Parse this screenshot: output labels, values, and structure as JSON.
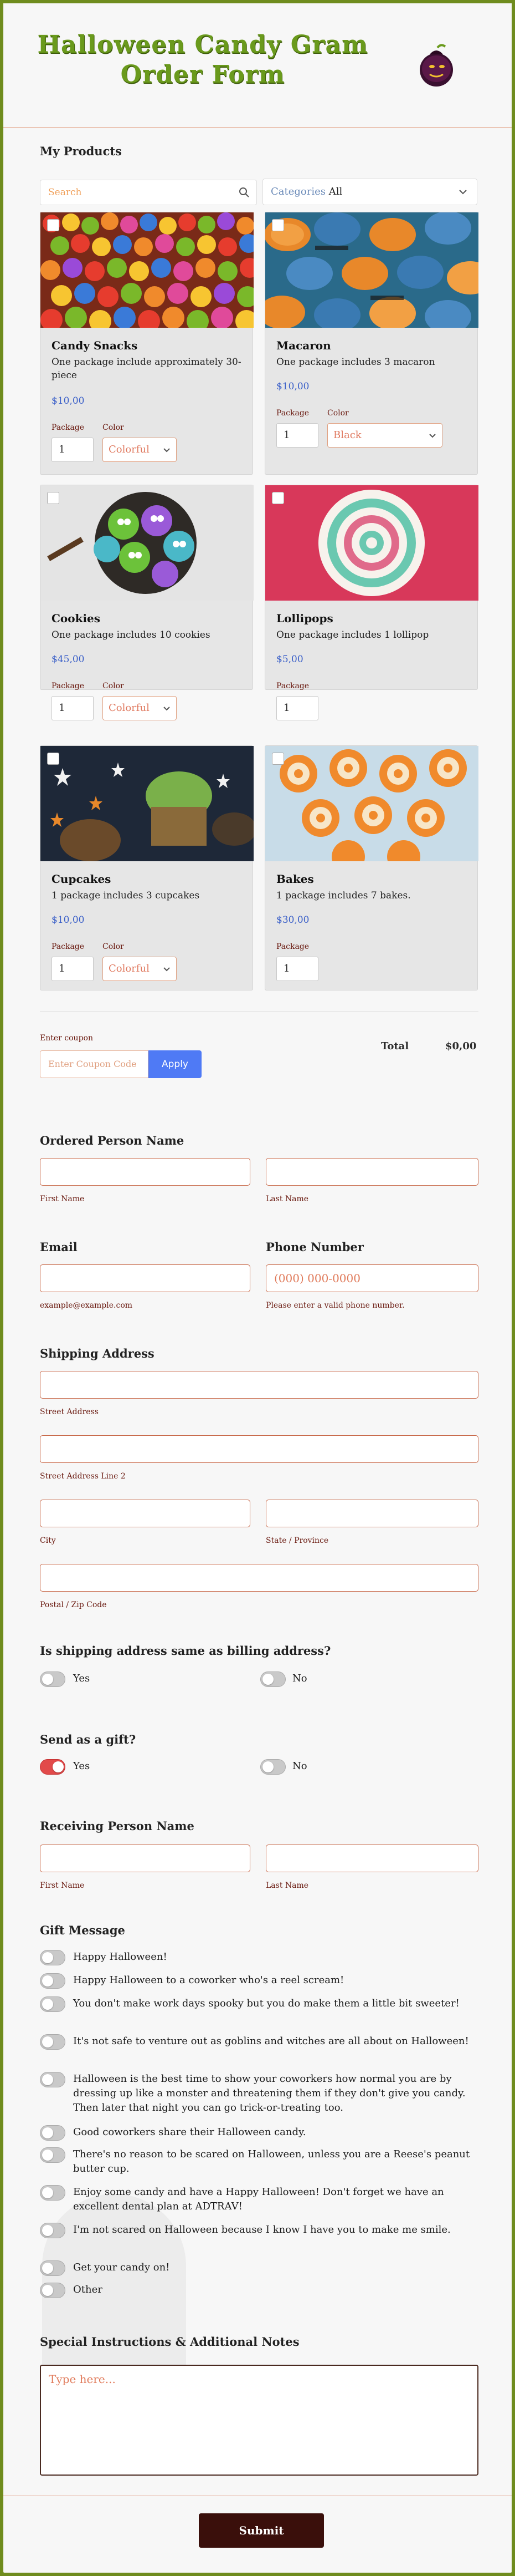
{
  "header": {
    "title_line1": "Halloween Candy Gram",
    "title_line2": "Order Form"
  },
  "products_section": {
    "title": "My Products",
    "search_placeholder": "Search",
    "category_label": "Categories",
    "category_value": "All"
  },
  "products": [
    {
      "name": "Candy Snacks",
      "description": "One package include approximately 30-piece",
      "price": "$10,00",
      "package_label": "Package",
      "quantity": "1",
      "color_label": "Color",
      "color_value": "Colorful"
    },
    {
      "name": "Macaron",
      "description": "One package includes 3 macaron",
      "price": "$10,00",
      "package_label": "Package",
      "quantity": "1",
      "color_label": "Color",
      "color_value": "Black"
    },
    {
      "name": "Cookies",
      "description": "One package includes 10 cookies",
      "price": "$45,00",
      "package_label": "Package",
      "quantity": "1",
      "color_label": "Color",
      "color_value": "Colorful"
    },
    {
      "name": "Lollipops",
      "description": "One package includes 1 lollipop",
      "price": "$5,00",
      "package_label": "Package",
      "quantity": "1"
    },
    {
      "name": "Cupcakes",
      "description": "1 package includes 3 cupcakes",
      "price": "$10,00",
      "package_label": "Package",
      "quantity": "1",
      "color_label": "Color",
      "color_value": "Colorful"
    },
    {
      "name": "Bakes",
      "description": "1 package includes 7 bakes.",
      "price": "$30,00",
      "package_label": "Package",
      "quantity": "1"
    }
  ],
  "coupon": {
    "label": "Enter coupon",
    "placeholder": "Enter Coupon Code",
    "apply": "Apply",
    "total_label": "Total",
    "total_value": "$0,00"
  },
  "ordered_person": {
    "title": "Ordered Person Name",
    "first": "First Name",
    "last": "Last Name"
  },
  "email": {
    "title": "Email",
    "hint": "example@example.com"
  },
  "phone": {
    "title": "Phone Number",
    "placeholder": "(000) 000-0000",
    "hint": "Please enter a valid phone number."
  },
  "shipping": {
    "title": "Shipping Address",
    "street": "Street Address",
    "street2": "Street Address Line 2",
    "city": "City",
    "state": "State / Province",
    "postal": "Postal / Zip Code"
  },
  "same_billing": {
    "question": "Is shipping address same as billing address?",
    "yes": "Yes",
    "no": "No"
  },
  "gift": {
    "question": "Send as a gift?",
    "yes": "Yes",
    "no": "No"
  },
  "receiving_person": {
    "title": "Receiving Person Name",
    "first": "First Name",
    "last": "Last Name"
  },
  "gift_message": {
    "title": "Gift Message",
    "options": [
      "Happy Halloween!",
      "Happy Halloween to a coworker who's a reel scream!",
      "You don't make work days spooky but you do make them a little bit sweeter!",
      "It's not safe to venture out as goblins and witches are all about on Halloween!",
      "Halloween is the best time to show your coworkers how normal you are by dressing up like a monster and threatening them if they don't give you candy. Then later that night you can go trick-or-treating too.",
      "Good coworkers share their Halloween candy.",
      "There's no reason to be scared on Halloween, unless you are a Reese's peanut butter cup.",
      "Enjoy some candy and have a Happy Halloween! Don't forget we have an excellent dental plan at ADTRAV!",
      "I'm not scared on Halloween because I know I have you to make me smile.",
      "Get your candy on!",
      "Other"
    ]
  },
  "notes": {
    "title": "Special Instructions & Additional Notes",
    "placeholder": "Type here..."
  },
  "submit": "Submit",
  "colors": {
    "frame": "#6f8c1e",
    "title_green": "#6a9a1c",
    "apply_blue": "#4f7af5",
    "submit_brown": "#3a0f0b",
    "toggle_on": "#e24a4a",
    "price_blue": "#3a5fc8"
  }
}
